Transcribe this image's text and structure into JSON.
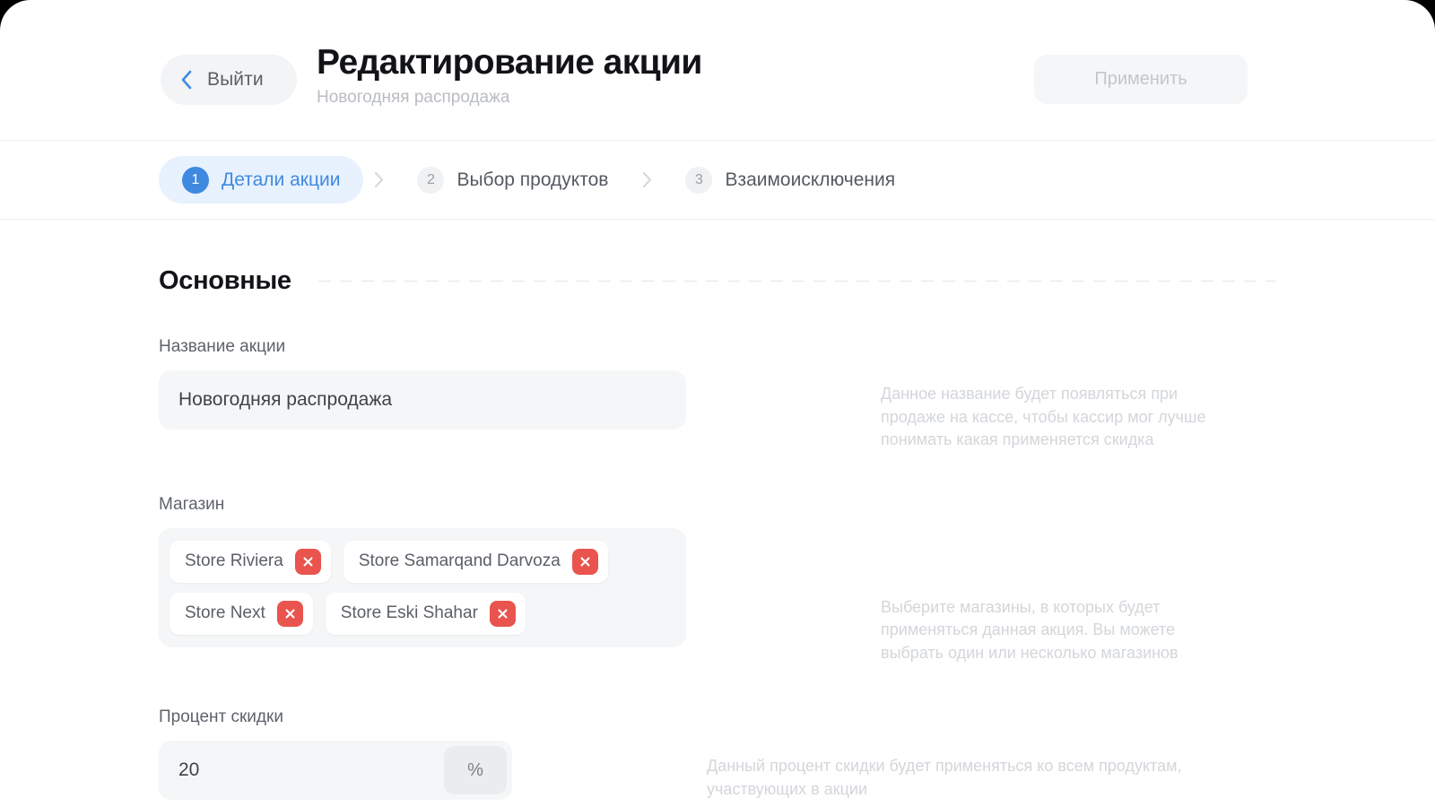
{
  "header": {
    "back_label": "Выйти",
    "back_icon": "chevron-left-icon",
    "title": "Редактирование акции",
    "subtitle": "Новогодняя распродажа",
    "apply_label": "Применить"
  },
  "stepper": {
    "separator_icon": "chevron-right-icon",
    "steps": [
      {
        "num": "1",
        "label": "Детали акции",
        "active": true
      },
      {
        "num": "2",
        "label": "Выбор продуктов",
        "active": false
      },
      {
        "num": "3",
        "label": "Взаимоисключения",
        "active": false
      }
    ]
  },
  "section": {
    "title": "Основные"
  },
  "fields": {
    "name": {
      "label": "Название акции",
      "value": "Новогодняя распродажа",
      "placeholder": "Название акции",
      "hint": "Данное название будет появляться при продаже на кассе, чтобы кассир мог лучше понимать какая применяется скидка"
    },
    "store": {
      "label": "Магазин",
      "hint": "Выберите магазины, в которых будет применяться данная акция. Вы можете выбрать один или несколько магазинов",
      "remove_icon": "close-icon",
      "chips": [
        {
          "label": "Store Riviera"
        },
        {
          "label": "Store Samarqand Darvoza"
        },
        {
          "label": "Store Next"
        },
        {
          "label": "Store Eski Shahar"
        }
      ]
    },
    "discount": {
      "label": "Процент скидки",
      "value": "20",
      "placeholder": "0",
      "suffix": "%",
      "hint": "Данный процент скидки будет применяться ко всем продуктам, участвующих в акции"
    }
  },
  "colors": {
    "accent": "#3f8ae0",
    "accent_soft": "#e8f1fe",
    "danger": "#e9544e",
    "field_bg": "#f5f6f7",
    "text": "#111317",
    "muted": "#d3d6da"
  }
}
